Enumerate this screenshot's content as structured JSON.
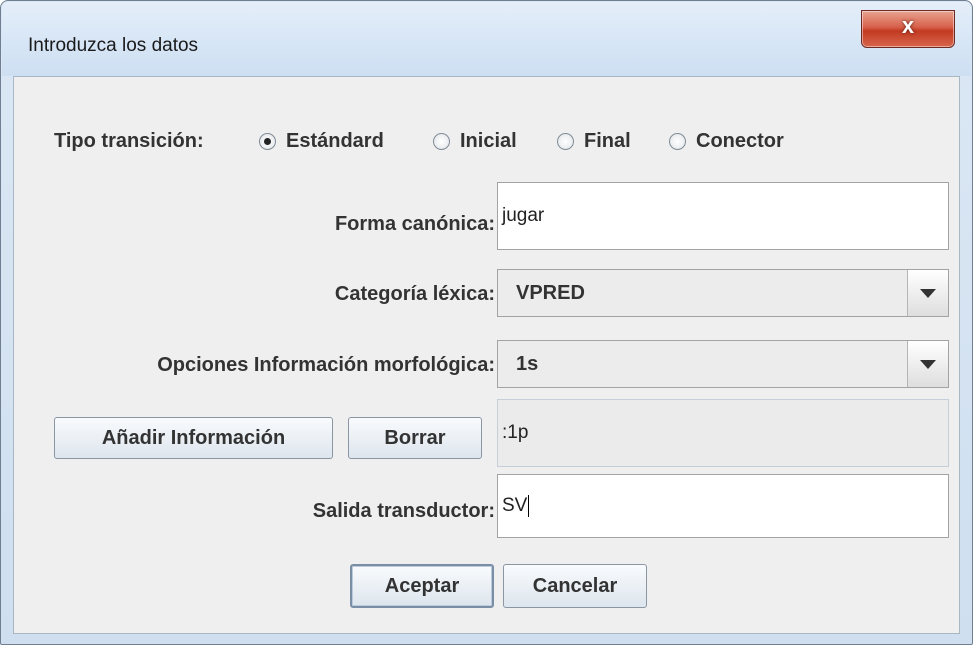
{
  "window": {
    "title": "Introduzca los datos",
    "close_label": "x"
  },
  "form": {
    "tipo_label": "Tipo transición:",
    "tipo_options": [
      "Estándard",
      "Inicial",
      "Final",
      "Conector"
    ],
    "tipo_selected": "Estándard",
    "forma_label": "Forma canónica:",
    "forma_value": "jugar",
    "categoria_label": "Categoría léxica:",
    "categoria_value": "VPRED",
    "opciones_label": "Opciones Información morfológica:",
    "opciones_value": "1s",
    "info_value": ":1p",
    "salida_label": "Salida transductor:",
    "salida_value": "SV"
  },
  "buttons": {
    "anadir": "Añadir Información",
    "borrar": "Borrar",
    "aceptar": "Aceptar",
    "cancelar": "Cancelar"
  }
}
